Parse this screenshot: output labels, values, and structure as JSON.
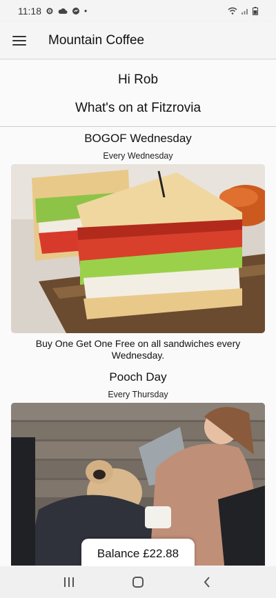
{
  "status": {
    "time": "11:18",
    "dot": "•"
  },
  "app": {
    "title": "Mountain Coffee"
  },
  "greeting": "Hi Rob",
  "location_heading": "What's on at Fitzrovia",
  "events": [
    {
      "title": "BOGOF Wednesday",
      "schedule": "Every Wednesday",
      "description": "Buy One Get One Free on all sandwiches every Wednesday."
    },
    {
      "title": "Pooch Day",
      "schedule": "Every Thursday"
    }
  ],
  "balance": {
    "label": "Balance £22.88"
  },
  "icons": [
    "settings-icon",
    "cloud-icon",
    "messenger-icon",
    "wifi-icon",
    "signal-icon",
    "battery-icon",
    "menu-icon",
    "recent-apps-icon",
    "home-icon",
    "back-icon"
  ],
  "colors": {
    "app_bar": "#f5f5f5",
    "background": "#fafafa",
    "accent": "#111111"
  }
}
